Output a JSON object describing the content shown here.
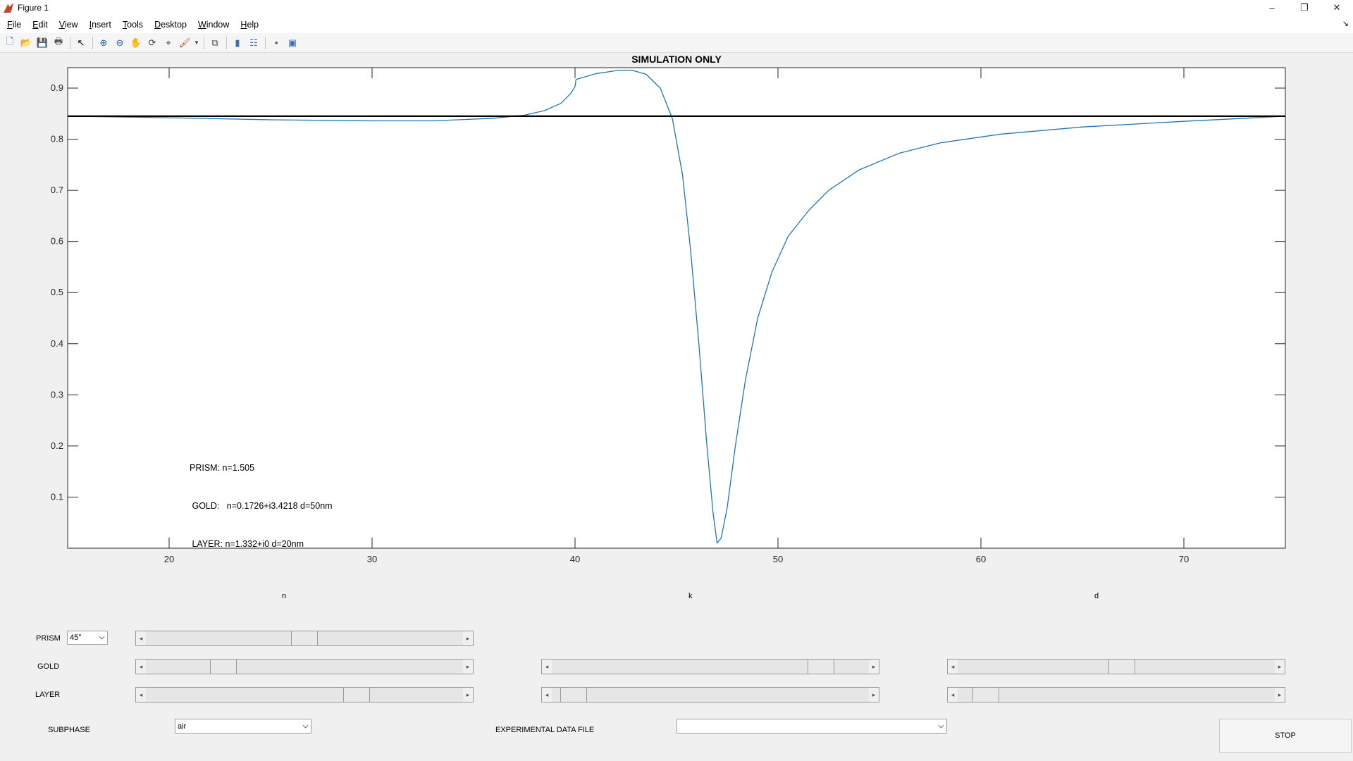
{
  "window": {
    "title": "Figure 1",
    "controls": [
      "–",
      "❐",
      "✕"
    ]
  },
  "menu": [
    "File",
    "Edit",
    "View",
    "Insert",
    "Tools",
    "Desktop",
    "Window",
    "Help"
  ],
  "toolbar": [
    "new-icon",
    "open-icon",
    "save-icon",
    "print-icon",
    "pointer-icon",
    "zoom-in-icon",
    "zoom-out-icon",
    "pan-icon",
    "rotate-icon",
    "data-cursor-icon",
    "brush-icon",
    "link-icon",
    "colorbar-icon",
    "legend-icon",
    "hide-plot-tools-icon",
    "show-plot-tools-icon"
  ],
  "chart_data": {
    "type": "line",
    "title": "SIMULATION ONLY",
    "xlabel": "",
    "ylabel": "",
    "xlim": [
      15,
      75
    ],
    "ylim": [
      0,
      0.94
    ],
    "xticks": [
      20,
      30,
      40,
      50,
      60,
      70
    ],
    "yticks": [
      0.1,
      0.2,
      0.3,
      0.4,
      0.5,
      0.6,
      0.7,
      0.8,
      0.9
    ],
    "series": [
      {
        "color": "#1f77b4",
        "x": [
          15,
          20,
          25,
          30,
          33,
          36,
          37.5,
          38.5,
          39.3,
          39.8,
          40,
          40.05,
          41,
          42,
          42.8,
          43.5,
          44.2,
          44.8,
          45.3,
          45.7,
          46.1,
          46.5,
          46.8,
          47,
          47.2,
          47.5,
          47.9,
          48.4,
          49,
          49.7,
          50.5,
          51.5,
          52.5,
          54,
          56,
          58,
          61,
          65,
          70,
          75
        ],
        "y": [
          0.845,
          0.842,
          0.838,
          0.836,
          0.836,
          0.841,
          0.847,
          0.856,
          0.87,
          0.89,
          0.903,
          0.917,
          0.928,
          0.934,
          0.935,
          0.927,
          0.9,
          0.84,
          0.73,
          0.58,
          0.4,
          0.2,
          0.07,
          0.01,
          0.02,
          0.08,
          0.2,
          0.33,
          0.45,
          0.54,
          0.61,
          0.66,
          0.7,
          0.74,
          0.773,
          0.793,
          0.81,
          0.824,
          0.835,
          0.845
        ]
      },
      {
        "color": "#000000",
        "x": [
          15,
          75
        ],
        "y": [
          0.845,
          0.845
        ]
      }
    ],
    "annotation": [
      "PRISM: n=1.505",
      " GOLD:   n=0.1726+i3.4218 d=50nm",
      " LAYER: n=1.332+i0 d=20nm"
    ]
  },
  "controls": {
    "column_labels": {
      "n": "n",
      "k": "k",
      "d": "d"
    },
    "rows": {
      "prism": "PRISM",
      "gold": "GOLD",
      "layer": "LAYER"
    },
    "prism_angle": "45°",
    "sliders": {
      "prism_n": 0.5,
      "gold_n": 0.22,
      "gold_k": 0.88,
      "gold_d": 0.52,
      "layer_n": 0.68,
      "layer_k": 0.03,
      "layer_d": 0.05
    },
    "subphase_label": "SUBPHASE",
    "subphase_value": "air",
    "experimental_label": "EXPERIMENTAL DATA FILE",
    "experimental_value": "",
    "stop_label": "STOP"
  }
}
